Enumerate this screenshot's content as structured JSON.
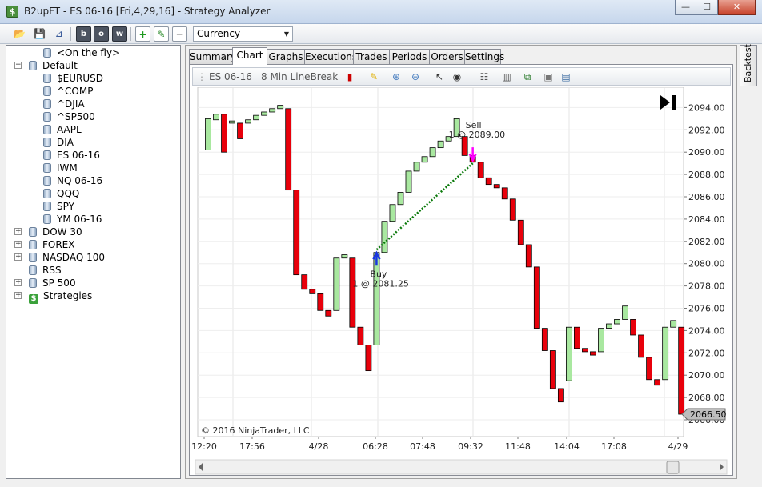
{
  "window": {
    "title": "B2upFT - ES 06-16 [Fri,4,29,16] - Strategy Analyzer",
    "controls": {
      "minimize": "—",
      "maximize": "☐",
      "close": "✕"
    }
  },
  "toolbar": {
    "icons": [
      "open-folder-icon",
      "save-icon",
      "pin-icon",
      "b-icon",
      "o-icon",
      "w-icon",
      "add-icon",
      "edit-icon",
      "remove-icon"
    ],
    "b_label": "b",
    "o_label": "o",
    "w_label": "w",
    "currency_label": "Currency"
  },
  "tree": {
    "items": [
      {
        "label": "<On the fly>"
      },
      {
        "label": "Default"
      },
      {
        "label": "$EURUSD"
      },
      {
        "label": "^COMP"
      },
      {
        "label": "^DJIA"
      },
      {
        "label": "^SP500"
      },
      {
        "label": "AAPL"
      },
      {
        "label": "DIA"
      },
      {
        "label": "ES 06-16"
      },
      {
        "label": "IWM"
      },
      {
        "label": "NQ 06-16"
      },
      {
        "label": "QQQ"
      },
      {
        "label": "SPY"
      },
      {
        "label": "YM 06-16"
      },
      {
        "label": "DOW 30"
      },
      {
        "label": "FOREX"
      },
      {
        "label": "NASDAQ 100"
      },
      {
        "label": "RSS"
      },
      {
        "label": "SP 500"
      },
      {
        "label": "Strategies"
      }
    ],
    "selected": "ES 06-16"
  },
  "tabs": [
    "Summary",
    "Chart",
    "Graphs",
    "Executions",
    "Trades",
    "Periods",
    "Orders",
    "Settings"
  ],
  "active_tab": "Chart",
  "side_tab": "Backtest",
  "chart_toolbar": {
    "instrument": "ES 06-16",
    "bar_type": "8 Min LineBreak"
  },
  "chart_data": {
    "type": "bar",
    "style": "line-break",
    "instrument": "ES 06-16",
    "up_color": "#a9e8a0",
    "down_color": "#e8000b",
    "ylim": [
      2066,
      2095
    ],
    "yticks": [
      "2094.00",
      "2092.00",
      "2090.00",
      "2088.00",
      "2086.00",
      "2084.00",
      "2082.00",
      "2080.00",
      "2078.00",
      "2076.00",
      "2074.00",
      "2072.00",
      "2070.00",
      "2068.00",
      "2066.00"
    ],
    "xticks": [
      "12:20",
      "17:56",
      "4/28",
      "06:28",
      "07:48",
      "09:32",
      "11:48",
      "14:04",
      "17:08",
      "4/29"
    ],
    "bricks": [
      {
        "dir": "up",
        "open": 2090.2,
        "close": 2093.0
      },
      {
        "dir": "up",
        "open": 2092.9,
        "close": 2093.4
      },
      {
        "dir": "down",
        "open": 2093.4,
        "close": 2090.0
      },
      {
        "dir": "up",
        "open": 2092.6,
        "close": 2092.8
      },
      {
        "dir": "down",
        "open": 2092.6,
        "close": 2091.2
      },
      {
        "dir": "up",
        "open": 2092.6,
        "close": 2092.9
      },
      {
        "dir": "up",
        "open": 2092.9,
        "close": 2093.3
      },
      {
        "dir": "up",
        "open": 2093.3,
        "close": 2093.6
      },
      {
        "dir": "up",
        "open": 2093.6,
        "close": 2093.9
      },
      {
        "dir": "up",
        "open": 2093.9,
        "close": 2094.2
      },
      {
        "dir": "down",
        "open": 2093.9,
        "close": 2086.6
      },
      {
        "dir": "down",
        "open": 2086.6,
        "close": 2079.0
      },
      {
        "dir": "down",
        "open": 2079.0,
        "close": 2077.7
      },
      {
        "dir": "down",
        "open": 2077.7,
        "close": 2077.3
      },
      {
        "dir": "down",
        "open": 2077.3,
        "close": 2075.8
      },
      {
        "dir": "down",
        "open": 2075.8,
        "close": 2075.3
      },
      {
        "dir": "up",
        "open": 2075.8,
        "close": 2080.5
      },
      {
        "dir": "up",
        "open": 2080.5,
        "close": 2080.8
      },
      {
        "dir": "down",
        "open": 2080.5,
        "close": 2074.3
      },
      {
        "dir": "down",
        "open": 2074.3,
        "close": 2072.7
      },
      {
        "dir": "down",
        "open": 2072.7,
        "close": 2070.4
      },
      {
        "dir": "up",
        "open": 2072.7,
        "close": 2081.0
      },
      {
        "dir": "up",
        "open": 2081.0,
        "close": 2083.8
      },
      {
        "dir": "up",
        "open": 2083.8,
        "close": 2085.3
      },
      {
        "dir": "up",
        "open": 2085.3,
        "close": 2086.4
      },
      {
        "dir": "up",
        "open": 2086.4,
        "close": 2088.3
      },
      {
        "dir": "up",
        "open": 2088.3,
        "close": 2089.1
      },
      {
        "dir": "up",
        "open": 2089.1,
        "close": 2089.6
      },
      {
        "dir": "up",
        "open": 2089.6,
        "close": 2090.4
      },
      {
        "dir": "up",
        "open": 2090.4,
        "close": 2091.0
      },
      {
        "dir": "up",
        "open": 2091.0,
        "close": 2091.4
      },
      {
        "dir": "up",
        "open": 2091.4,
        "close": 2093.0
      },
      {
        "dir": "down",
        "open": 2091.4,
        "close": 2089.7
      },
      {
        "dir": "down",
        "open": 2089.7,
        "close": 2089.1
      },
      {
        "dir": "down",
        "open": 2089.1,
        "close": 2087.7
      },
      {
        "dir": "down",
        "open": 2087.7,
        "close": 2087.1
      },
      {
        "dir": "down",
        "open": 2087.1,
        "close": 2086.8
      },
      {
        "dir": "down",
        "open": 2086.8,
        "close": 2085.8
      },
      {
        "dir": "down",
        "open": 2085.8,
        "close": 2083.9
      },
      {
        "dir": "down",
        "open": 2083.9,
        "close": 2081.7
      },
      {
        "dir": "down",
        "open": 2081.7,
        "close": 2079.7
      },
      {
        "dir": "down",
        "open": 2079.7,
        "close": 2074.2
      },
      {
        "dir": "down",
        "open": 2074.2,
        "close": 2072.2
      },
      {
        "dir": "down",
        "open": 2072.2,
        "close": 2068.8
      },
      {
        "dir": "down",
        "open": 2068.8,
        "close": 2067.6
      },
      {
        "dir": "up",
        "open": 2069.5,
        "close": 2074.3
      },
      {
        "dir": "down",
        "open": 2074.3,
        "close": 2072.4
      },
      {
        "dir": "down",
        "open": 2072.4,
        "close": 2072.1
      },
      {
        "dir": "down",
        "open": 2072.1,
        "close": 2071.8
      },
      {
        "dir": "up",
        "open": 2072.1,
        "close": 2074.2
      },
      {
        "dir": "up",
        "open": 2074.2,
        "close": 2074.6
      },
      {
        "dir": "up",
        "open": 2074.6,
        "close": 2075.0
      },
      {
        "dir": "up",
        "open": 2075.0,
        "close": 2076.2
      },
      {
        "dir": "down",
        "open": 2075.0,
        "close": 2073.6
      },
      {
        "dir": "down",
        "open": 2073.6,
        "close": 2071.6
      },
      {
        "dir": "down",
        "open": 2071.6,
        "close": 2069.6
      },
      {
        "dir": "down",
        "open": 2069.6,
        "close": 2069.1
      },
      {
        "dir": "up",
        "open": 2069.6,
        "close": 2074.3
      },
      {
        "dir": "up",
        "open": 2074.3,
        "close": 2074.9
      },
      {
        "dir": "down",
        "open": 2074.3,
        "close": 2066.5
      }
    ],
    "annotations": {
      "buy": {
        "label": "Buy",
        "detail": "1 @ 2081.25",
        "bar_index": 21,
        "price": 2081.25
      },
      "sell": {
        "label": "Sell",
        "detail": "1 @ 2089.00",
        "bar_index": 33,
        "price": 2089.0
      }
    },
    "last_price_label": "2066.50",
    "copyright": "© 2016 NinjaTrader, LLC"
  }
}
